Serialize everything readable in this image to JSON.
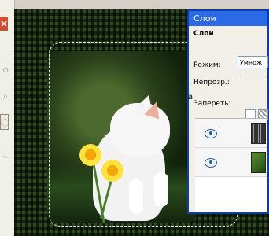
{
  "panel": {
    "title": "Слои",
    "header": "Слои",
    "mode_label": "Режим:",
    "mode_value": "Умнож",
    "opacity_label": "Непрозр.:",
    "lock_label": "Запереть:"
  },
  "edge_label": "a",
  "icons": [
    "close-icon",
    "eye-icon"
  ]
}
